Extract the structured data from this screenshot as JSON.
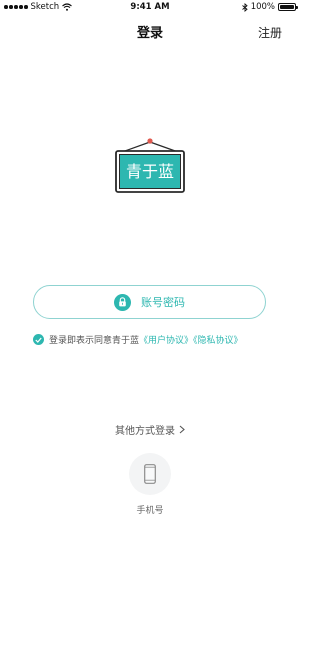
{
  "status_bar": {
    "carrier": "Sketch",
    "time": "9:41 AM",
    "battery": "100%",
    "battery_level": 1.0
  },
  "nav": {
    "title": "登录",
    "register": "注册"
  },
  "logo": {
    "text": "青于蓝"
  },
  "login": {
    "account_password": "账号密码"
  },
  "agreement": {
    "prefix": "登录即表示同意青于蓝",
    "user_agreement": "《用户协议》",
    "privacy_agreement": "《隐私协议》"
  },
  "other_methods": {
    "label": "其他方式登录"
  },
  "phone_login": {
    "label": "手机号"
  },
  "colors": {
    "accent": "#2db7b0",
    "button_border": "#8fd3d1",
    "logo_frame": "#2a2a2a"
  },
  "icons": [
    "signal-dots-icon",
    "wifi-icon",
    "bluetooth-icon",
    "battery-icon",
    "lock-icon",
    "check-icon",
    "chevron-right-icon",
    "phone-icon"
  ]
}
